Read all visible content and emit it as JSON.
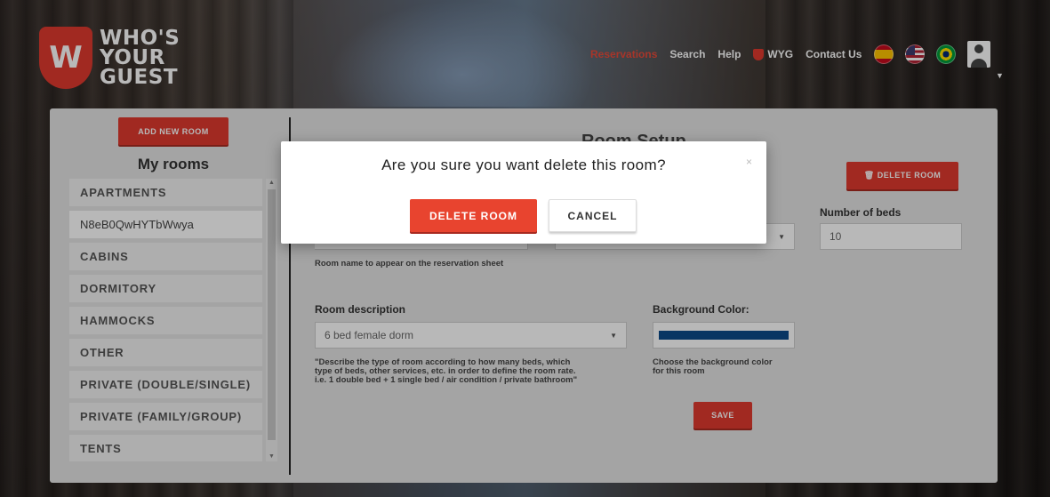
{
  "brand": {
    "logo_letter": "W",
    "line1": "WHO'S",
    "line2": "YOUR",
    "line3": "GUEST"
  },
  "nav": {
    "items": [
      "Reservations",
      "Search",
      "Help",
      "WYG",
      "Contact Us"
    ],
    "active": "Reservations",
    "flags": [
      "spain-flag-icon",
      "usa-flag-icon",
      "brazil-flag-icon"
    ]
  },
  "sidebar": {
    "add_button": "ADD NEW ROOM",
    "title": "My rooms",
    "rooms": [
      "APARTMENTS",
      "N8eB0QwHYTbWwya",
      "CABINS",
      "DORMITORY",
      "HAMMOCKS",
      "OTHER",
      "PRIVATE (DOUBLE/SINGLE)",
      "PRIVATE (FAMILY/GROUP)",
      "TENTS"
    ]
  },
  "setup": {
    "title": "Room Setup",
    "delete_button": "DELETE ROOM",
    "beds_label": "Number of beds",
    "beds_value": "10",
    "room_name_help": "Room name to appear on the reservation sheet",
    "description_label": "Room description",
    "description_value": "6 bed female dorm",
    "description_help_1": "\"Describe the type of room according to how many beds, which",
    "description_help_2": "type of beds, other services, etc. in order to define the room rate.",
    "description_help_3": "i.e. 1 double bed + 1 single bed / air condition / private bathroom\"",
    "bg_color_label": "Background Color:",
    "bg_color_value": "#0c4a8a",
    "bg_color_help_1": "Choose the background color",
    "bg_color_help_2": "for this room",
    "save_button": "SAVE"
  },
  "modal": {
    "title": "Are you sure you want delete this room?",
    "close": "×",
    "delete_button": "DELETE ROOM",
    "cancel_button": "CANCEL"
  },
  "colors": {
    "accent": "#e03a2f",
    "active_nav": "#e84a3a"
  }
}
